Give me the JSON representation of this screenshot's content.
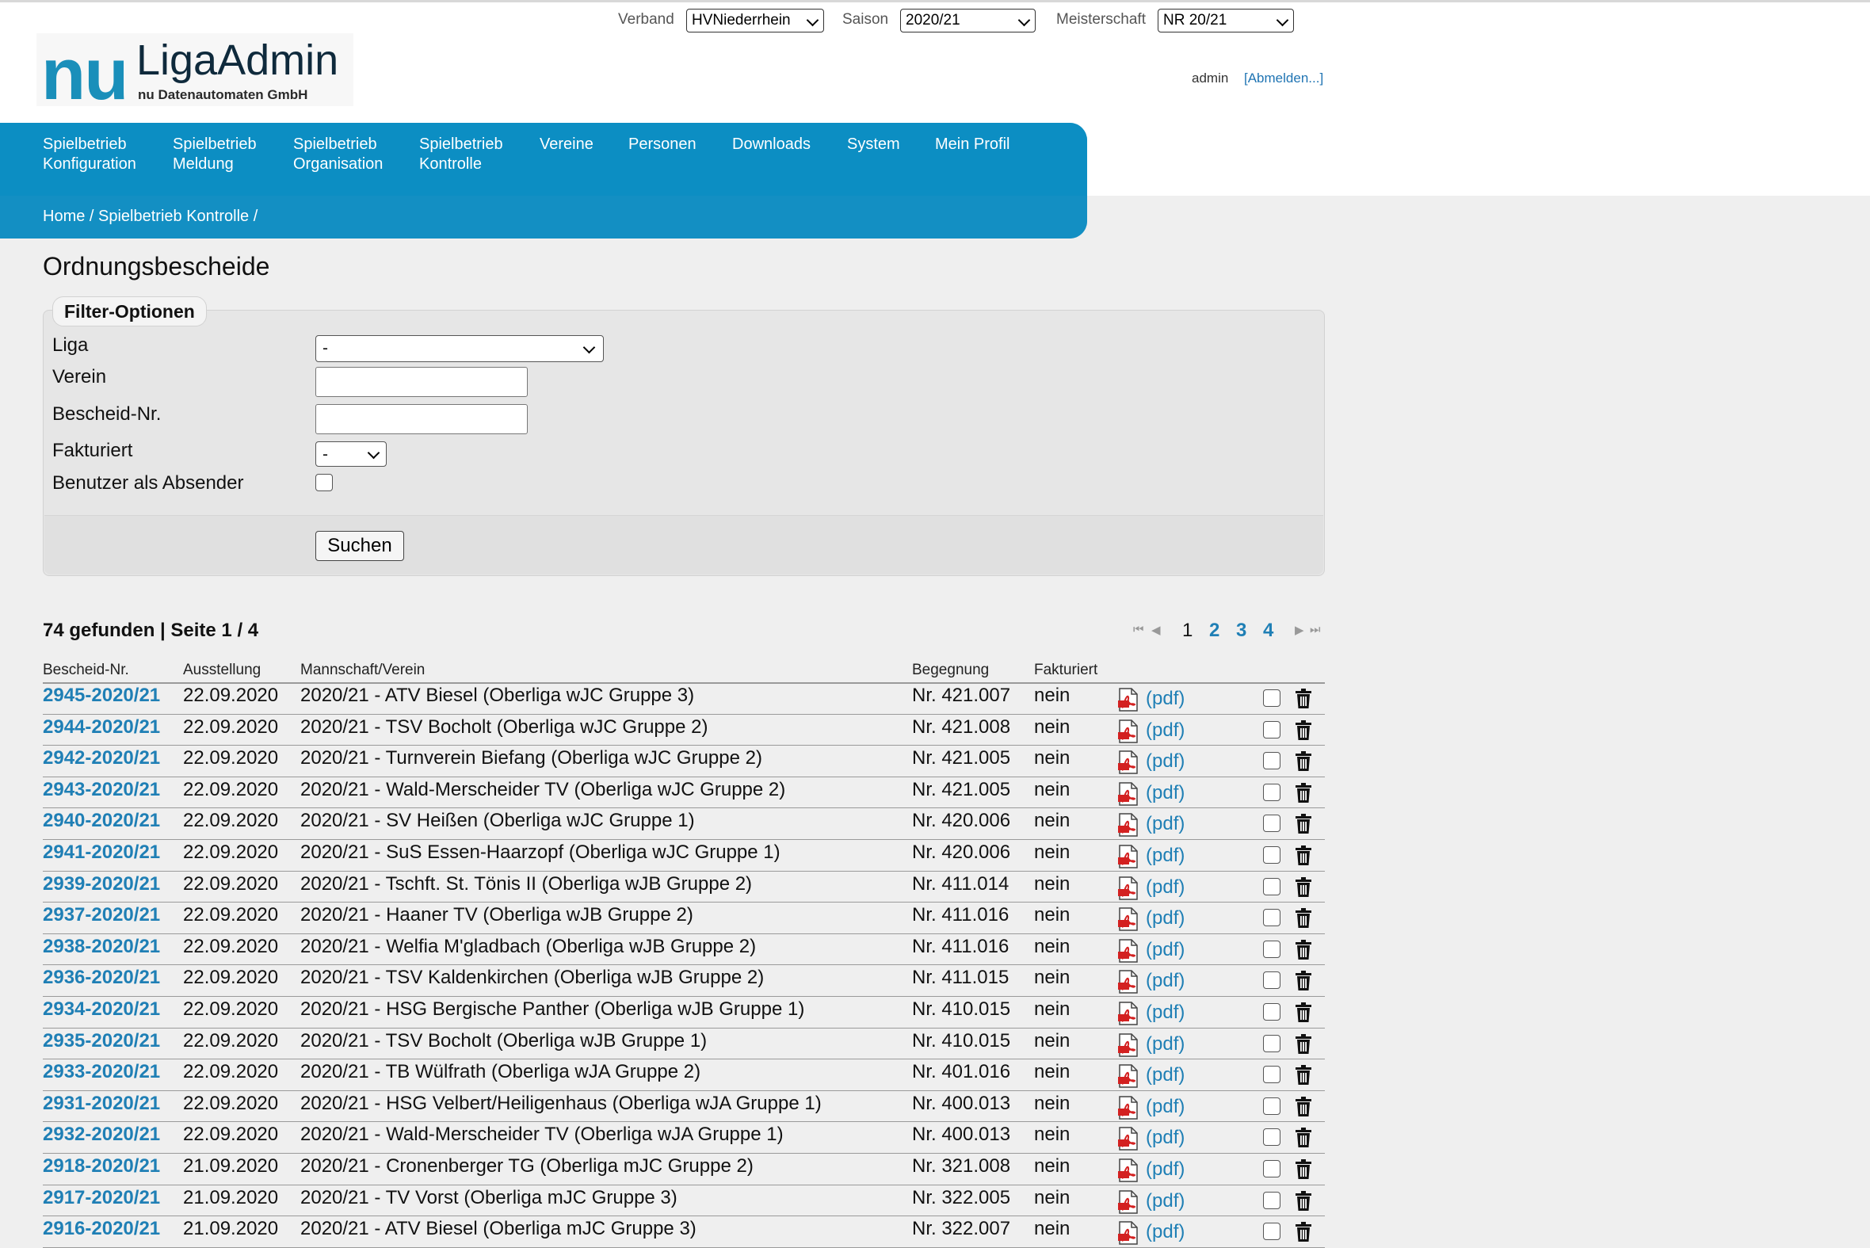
{
  "top_selectors": {
    "verband_label": "Verband",
    "verband_value": "HVNiederrhein",
    "saison_label": "Saison",
    "saison_value": "2020/21",
    "meisterschaft_label": "Meisterschaft",
    "meisterschaft_value": "NR 20/21"
  },
  "logo": {
    "nu": "nu",
    "title": "LigaAdmin",
    "subtitle": "nu Datenautomaten GmbH"
  },
  "user": {
    "name": "admin",
    "logout": "[Abmelden...]"
  },
  "nav": [
    {
      "line1": "Spielbetrieb",
      "line2": "Konfiguration"
    },
    {
      "line1": "Spielbetrieb",
      "line2": "Meldung"
    },
    {
      "line1": "Spielbetrieb",
      "line2": "Organisation"
    },
    {
      "line1": "Spielbetrieb",
      "line2": "Kontrolle"
    },
    {
      "line1": "Vereine",
      "line2": ""
    },
    {
      "line1": "Personen",
      "line2": ""
    },
    {
      "line1": "Downloads",
      "line2": ""
    },
    {
      "line1": "System",
      "line2": ""
    },
    {
      "line1": "Mein Profil",
      "line2": ""
    }
  ],
  "breadcrumb": "Home / Spielbetrieb Kontrolle /",
  "page_title": "Ordnungsbescheide",
  "filter": {
    "legend": "Filter-Optionen",
    "liga_label": "Liga",
    "liga_value": "-",
    "verein_label": "Verein",
    "verein_value": "",
    "bescheid_label": "Bescheid-Nr.",
    "bescheid_value": "",
    "fakturiert_label": "Fakturiert",
    "fakturiert_value": "-",
    "absender_label": "Benutzer als Absender",
    "search_button": "Suchen"
  },
  "results": {
    "count_text": "74 gefunden | Seite 1 / 4",
    "pages": [
      "1",
      "2",
      "3",
      "4"
    ],
    "current_page": "1"
  },
  "table": {
    "headers": [
      "Bescheid-Nr.",
      "Ausstellung",
      "Mannschaft/Verein",
      "Begegnung",
      "Fakturiert"
    ],
    "pdf_label": "(pdf)",
    "rows": [
      {
        "nr": "2945-2020/21",
        "date": "22.09.2020",
        "team": "2020/21 - ATV Biesel (Oberliga wJC Gruppe 3)",
        "begegnung": "Nr. 421.007",
        "fakturiert": "nein"
      },
      {
        "nr": "2944-2020/21",
        "date": "22.09.2020",
        "team": "2020/21 - TSV Bocholt (Oberliga wJC Gruppe 2)",
        "begegnung": "Nr. 421.008",
        "fakturiert": "nein"
      },
      {
        "nr": "2942-2020/21",
        "date": "22.09.2020",
        "team": "2020/21 - Turnverein Biefang (Oberliga wJC Gruppe 2)",
        "begegnung": "Nr. 421.005",
        "fakturiert": "nein"
      },
      {
        "nr": "2943-2020/21",
        "date": "22.09.2020",
        "team": "2020/21 - Wald-Merscheider TV (Oberliga wJC Gruppe 2)",
        "begegnung": "Nr. 421.005",
        "fakturiert": "nein"
      },
      {
        "nr": "2940-2020/21",
        "date": "22.09.2020",
        "team": "2020/21 - SV Heißen (Oberliga wJC Gruppe 1)",
        "begegnung": "Nr. 420.006",
        "fakturiert": "nein"
      },
      {
        "nr": "2941-2020/21",
        "date": "22.09.2020",
        "team": "2020/21 - SuS Essen-Haarzopf (Oberliga wJC Gruppe 1)",
        "begegnung": "Nr. 420.006",
        "fakturiert": "nein"
      },
      {
        "nr": "2939-2020/21",
        "date": "22.09.2020",
        "team": "2020/21 - Tschft. St. Tönis II (Oberliga wJB Gruppe 2)",
        "begegnung": "Nr. 411.014",
        "fakturiert": "nein"
      },
      {
        "nr": "2937-2020/21",
        "date": "22.09.2020",
        "team": "2020/21 - Haaner TV (Oberliga wJB Gruppe 2)",
        "begegnung": "Nr. 411.016",
        "fakturiert": "nein"
      },
      {
        "nr": "2938-2020/21",
        "date": "22.09.2020",
        "team": "2020/21 - Welfia M'gladbach (Oberliga wJB Gruppe 2)",
        "begegnung": "Nr. 411.016",
        "fakturiert": "nein"
      },
      {
        "nr": "2936-2020/21",
        "date": "22.09.2020",
        "team": "2020/21 - TSV Kaldenkirchen (Oberliga wJB Gruppe 2)",
        "begegnung": "Nr. 411.015",
        "fakturiert": "nein"
      },
      {
        "nr": "2934-2020/21",
        "date": "22.09.2020",
        "team": "2020/21 - HSG Bergische Panther (Oberliga wJB Gruppe 1)",
        "begegnung": "Nr. 410.015",
        "fakturiert": "nein"
      },
      {
        "nr": "2935-2020/21",
        "date": "22.09.2020",
        "team": "2020/21 - TSV Bocholt (Oberliga wJB Gruppe 1)",
        "begegnung": "Nr. 410.015",
        "fakturiert": "nein"
      },
      {
        "nr": "2933-2020/21",
        "date": "22.09.2020",
        "team": "2020/21 - TB Wülfrath (Oberliga wJA Gruppe 2)",
        "begegnung": "Nr. 401.016",
        "fakturiert": "nein"
      },
      {
        "nr": "2931-2020/21",
        "date": "22.09.2020",
        "team": "2020/21 - HSG Velbert/Heiligenhaus (Oberliga wJA Gruppe 1)",
        "begegnung": "Nr. 400.013",
        "fakturiert": "nein"
      },
      {
        "nr": "2932-2020/21",
        "date": "22.09.2020",
        "team": "2020/21 - Wald-Merscheider TV (Oberliga wJA Gruppe 1)",
        "begegnung": "Nr. 400.013",
        "fakturiert": "nein"
      },
      {
        "nr": "2918-2020/21",
        "date": "21.09.2020",
        "team": "2020/21 - Cronenberger TG (Oberliga mJC Gruppe 2)",
        "begegnung": "Nr. 321.008",
        "fakturiert": "nein"
      },
      {
        "nr": "2917-2020/21",
        "date": "21.09.2020",
        "team": "2020/21 - TV Vorst (Oberliga mJC Gruppe 3)",
        "begegnung": "Nr. 322.005",
        "fakturiert": "nein"
      },
      {
        "nr": "2916-2020/21",
        "date": "21.09.2020",
        "team": "2020/21 - ATV Biesel (Oberliga mJC Gruppe 3)",
        "begegnung": "Nr. 322.007",
        "fakturiert": "nein"
      }
    ]
  }
}
